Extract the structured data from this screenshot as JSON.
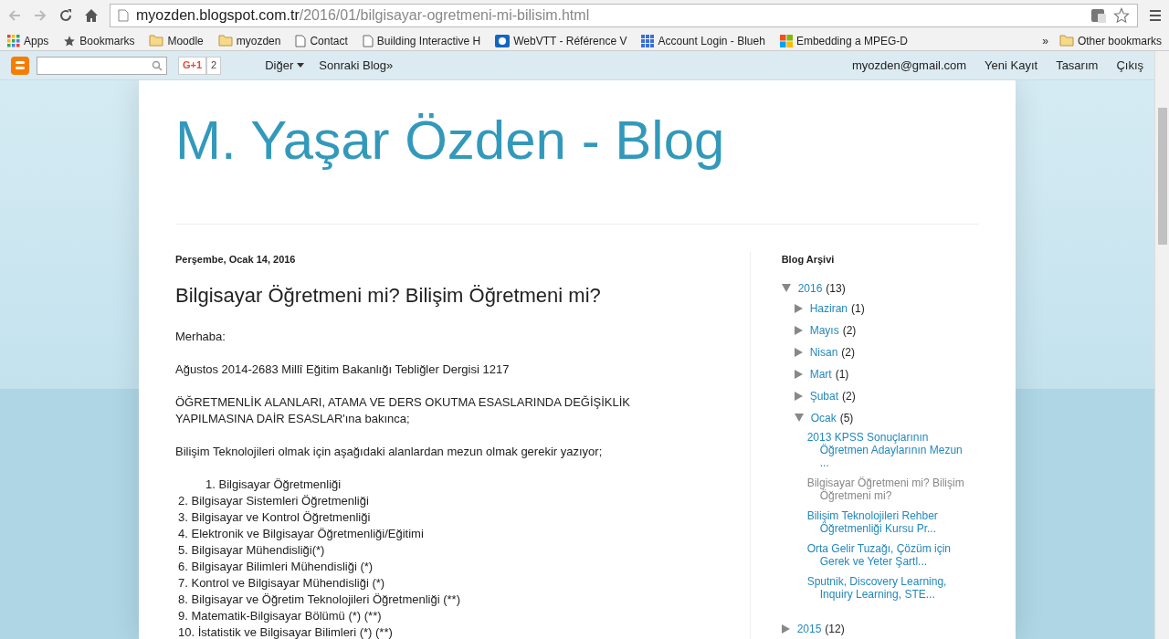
{
  "browser": {
    "url_host": "myozden.blogspot.com.tr",
    "url_path": "/2016/01/bilgisayar-ogretmeni-mi-bilisim.html",
    "bookmarks": [
      {
        "kind": "apps",
        "label": "Apps"
      },
      {
        "kind": "star",
        "label": "Bookmarks"
      },
      {
        "kind": "folder",
        "label": "Moodle"
      },
      {
        "kind": "folder",
        "label": "myozden"
      },
      {
        "kind": "page",
        "label": "Contact"
      },
      {
        "kind": "page",
        "label": "Building Interactive H"
      },
      {
        "kind": "webvtt",
        "label": "WebVTT - Référence V"
      },
      {
        "kind": "grid",
        "label": "Account Login - Blueh"
      },
      {
        "kind": "windows",
        "label": "Embedding a MPEG-D"
      }
    ],
    "overflow": "»",
    "other_bookmarks": "Other bookmarks"
  },
  "navbar": {
    "plus_label": "G+1",
    "plus_count": "2",
    "more": "Diğer",
    "next_blog": "Sonraki Blog»",
    "links": [
      "myozden@gmail.com",
      "Yeni Kayıt",
      "Tasarım",
      "Çıkış"
    ]
  },
  "blog_title": "M. Yaşar Özden - Blog",
  "post": {
    "date": "Perşembe, Ocak 14, 2016",
    "title": "Bilgisayar Öğretmeni mi? Bilişim Öğretmeni mi?",
    "paragraphs": [
      "Merhaba:",
      "Ağustos 2014-2683 Millî Eğitim Bakanlığı Tebliğler Dergisi 1217",
      "ÖĞRETMENLİK ALANLARI, ATAMA VE DERS OKUTMA ESASLARINDA DEĞİŞİKLİK YAPILMASINA DAİR ESASLAR'ına bakınca;",
      "Bilişim Teknolojileri olmak için aşağıdaki alanlardan mezun olmak gerekir yazıyor;"
    ],
    "list": [
      {
        "kind": "indented",
        "number": "1.",
        "text": "Bilgisayar Öğretmenliği"
      },
      {
        "kind": "plain",
        "number": "2.",
        "text": "Bilgisayar Sistemleri Öğretmenliği"
      },
      {
        "kind": "plain",
        "number": "3.",
        "text": "Bilgisayar ve Kontrol Öğretmenliği"
      },
      {
        "kind": "plain",
        "number": "4.",
        "text": "Elektronik ve Bilgisayar Öğretmenliği/Eğitimi"
      },
      {
        "kind": "plain",
        "number": "5.",
        "text": "Bilgisayar Mühendisliği(*)"
      },
      {
        "kind": "plain",
        "number": "6.",
        "text": "Bilgisayar Bilimleri Mühendisliği (*)"
      },
      {
        "kind": "plain",
        "number": "7.",
        "text": "Kontrol ve Bilgisayar Mühendisliği (*)"
      },
      {
        "kind": "plain",
        "number": "8.",
        "text": "Bilgisayar ve Öğretim Teknolojileri Öğretmenliği (**)"
      },
      {
        "kind": "plain",
        "number": "9.",
        "text": "Matematik-Bilgisayar Bölümü (*) (**)"
      },
      {
        "kind": "plain",
        "number": "10.",
        "text": "İstatistik ve Bilgisayar Bilimleri (*) (**)"
      }
    ]
  },
  "sidebar": {
    "title": "Blog Arşivi",
    "archive": [
      {
        "label": "2016",
        "count": "(13)",
        "expanded": true,
        "children": [
          {
            "label": "Haziran",
            "count": "(1)",
            "expanded": false
          },
          {
            "label": "Mayıs",
            "count": "(2)",
            "expanded": false
          },
          {
            "label": "Nisan",
            "count": "(2)",
            "expanded": false
          },
          {
            "label": "Mart",
            "count": "(1)",
            "expanded": false
          },
          {
            "label": "Şubat",
            "count": "(2)",
            "expanded": false
          },
          {
            "label": "Ocak",
            "count": "(5)",
            "expanded": true,
            "posts": [
              {
                "title": "2013 KPSS Sonuçlarının Öğretmen Adaylarının Mezun ...",
                "selected": false
              },
              {
                "title": "Bilgisayar Öğretmeni mi? Bilişim Öğretmeni mi?",
                "selected": true
              },
              {
                "title": "Bilişim Teknolojileri Rehber Öğretmenliği Kursu Pr...",
                "selected": false
              },
              {
                "title": "Orta Gelir Tuzağı, Çözüm için Gerek ve Yeter Şartl...",
                "selected": false
              },
              {
                "title": "Sputnik, Discovery Learning, Inquiry Learning, STE...",
                "selected": false
              }
            ]
          }
        ]
      },
      {
        "label": "2015",
        "count": "(12)",
        "expanded": false
      }
    ]
  }
}
